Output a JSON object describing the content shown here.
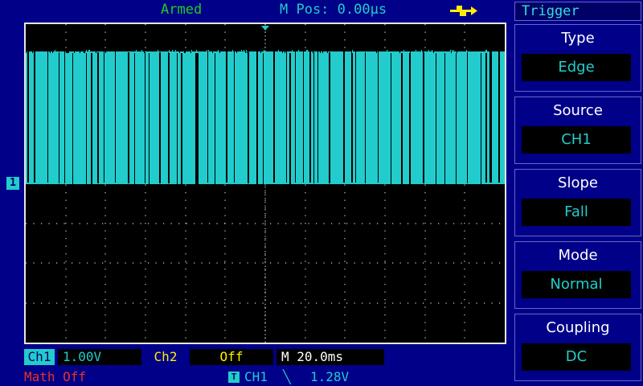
{
  "status": {
    "state": "Armed",
    "mpos_label": "M Pos:",
    "mpos_value": "0.00µs"
  },
  "menu": {
    "title": "Trigger",
    "items": [
      {
        "label": "Type",
        "value": "Edge"
      },
      {
        "label": "Source",
        "value": "CH1"
      },
      {
        "label": "Slope",
        "value": "Fall"
      },
      {
        "label": "Mode",
        "value": "Normal"
      },
      {
        "label": "Coupling",
        "value": "DC"
      }
    ]
  },
  "channels": {
    "ch1_label": "Ch1",
    "ch1_scale": "1.00V",
    "ch2_label": "Ch2",
    "ch2_scale": "Off",
    "timebase": "M 20.0ms",
    "math": "Math Off",
    "trigger_src": "CH1",
    "trigger_slope_symbol": "╲",
    "trigger_level": "1.28V",
    "channel_marker": "1",
    "trigger_marker": "T"
  },
  "colors": {
    "ch1": "#22cccc",
    "grid": "#cfcfcf",
    "background": "#000088",
    "armed": "#22cc22"
  }
}
